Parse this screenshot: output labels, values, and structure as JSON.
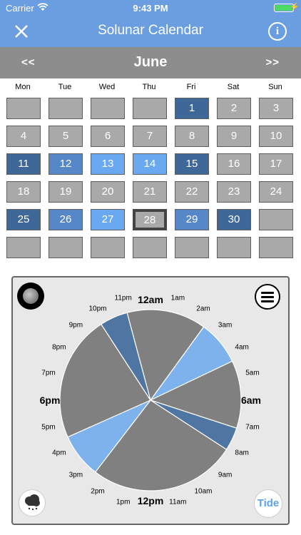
{
  "status_bar": {
    "carrier": "Carrier",
    "time": "9:43 PM"
  },
  "nav": {
    "title": "Solunar Calendar"
  },
  "calendar": {
    "prev_label": "<<",
    "next_label": ">>",
    "month": "June",
    "weekdays": [
      "Mon",
      "Tue",
      "Wed",
      "Thu",
      "Fri",
      "Sat",
      "Sun"
    ],
    "rows": [
      [
        {
          "t": ""
        },
        {
          "t": ""
        },
        {
          "t": ""
        },
        {
          "t": ""
        },
        {
          "t": "1",
          "c": "d"
        },
        {
          "t": "2"
        },
        {
          "t": "3"
        }
      ],
      [
        {
          "t": "4"
        },
        {
          "t": "5"
        },
        {
          "t": "6"
        },
        {
          "t": "7"
        },
        {
          "t": "8"
        },
        {
          "t": "9"
        },
        {
          "t": "10"
        }
      ],
      [
        {
          "t": "11",
          "c": "d"
        },
        {
          "t": "12",
          "c": "m"
        },
        {
          "t": "13",
          "c": "l"
        },
        {
          "t": "14",
          "c": "l"
        },
        {
          "t": "15",
          "c": "d"
        },
        {
          "t": "16"
        },
        {
          "t": "17"
        }
      ],
      [
        {
          "t": "18"
        },
        {
          "t": "19"
        },
        {
          "t": "20"
        },
        {
          "t": "21"
        },
        {
          "t": "22"
        },
        {
          "t": "23"
        },
        {
          "t": "24"
        }
      ],
      [
        {
          "t": "25",
          "c": "d"
        },
        {
          "t": "26",
          "c": "m"
        },
        {
          "t": "27",
          "c": "l"
        },
        {
          "t": "28",
          "c": "g",
          "sel": true
        },
        {
          "t": "29",
          "c": "m"
        },
        {
          "t": "30",
          "c": "d"
        },
        {
          "t": ""
        }
      ],
      [
        {
          "t": ""
        },
        {
          "t": ""
        },
        {
          "t": ""
        },
        {
          "t": ""
        },
        {
          "t": ""
        },
        {
          "t": ""
        },
        {
          "t": ""
        }
      ]
    ]
  },
  "clock": {
    "hours": [
      "12am",
      "1am",
      "2am",
      "3am",
      "4am",
      "5am",
      "6am",
      "7am",
      "8am",
      "9am",
      "10am",
      "11am",
      "12pm",
      "1pm",
      "2pm",
      "3pm",
      "4pm",
      "5pm",
      "6pm",
      "7pm",
      "8pm",
      "9pm",
      "10pm",
      "11pm"
    ],
    "tide_label": "Tide"
  },
  "colors": {
    "accent": "#6a9ee0",
    "dark": "#3f6898",
    "medium": "#5687c6",
    "light": "#6aa9f0",
    "gray": "#a9a9a9"
  },
  "chart_data": {
    "type": "pie",
    "unit": "hours of day (0-24)",
    "segments": [
      {
        "start": 23.0,
        "end": 2.4,
        "color": "#808080"
      },
      {
        "start": 2.4,
        "end": 4.3,
        "color": "#7eb2ed"
      },
      {
        "start": 4.3,
        "end": 7.2,
        "color": "#808080"
      },
      {
        "start": 7.2,
        "end": 8.2,
        "color": "#4f75a3"
      },
      {
        "start": 8.2,
        "end": 14.5,
        "color": "#808080"
      },
      {
        "start": 14.5,
        "end": 16.4,
        "color": "#7eb2ed"
      },
      {
        "start": 16.4,
        "end": 21.8,
        "color": "#808080"
      },
      {
        "start": 21.8,
        "end": 23.0,
        "color": "#4f75a3"
      }
    ]
  }
}
